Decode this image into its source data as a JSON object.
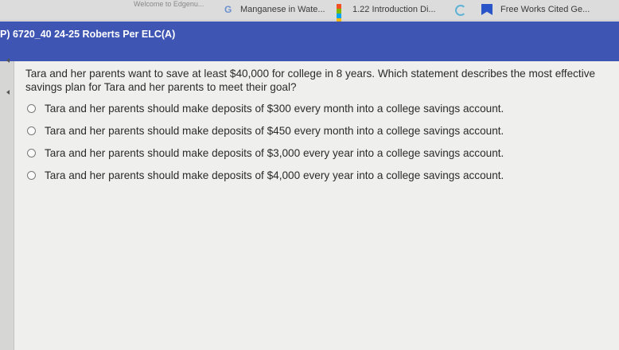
{
  "bookmarks": {
    "edgenuity": "Welcome to Edgenu...",
    "manganese": "Manganese in Wate...",
    "intro": "1.22 Introduction Di...",
    "works_cited": "Free Works Cited Ge..."
  },
  "header": {
    "course_title": "P) 6720_40 24-25 Roberts Per ELC(A)"
  },
  "question": {
    "text": "Tara and her parents want to save at least $40,000 for college in 8 years. Which statement describes the most effective savings plan for Tara and her parents to meet their goal?",
    "options": [
      "Tara and her parents should make deposits of $300 every month into a college savings account.",
      "Tara and her parents should make deposits of $450 every month into a college savings account.",
      "Tara and her parents should make deposits of $3,000 every year into a college savings account.",
      "Tara and her parents should make deposits of $4,000 every year into a college savings account."
    ]
  },
  "colors": {
    "header": "#3e55b3",
    "bookmark_blue": "#2a55c8"
  }
}
